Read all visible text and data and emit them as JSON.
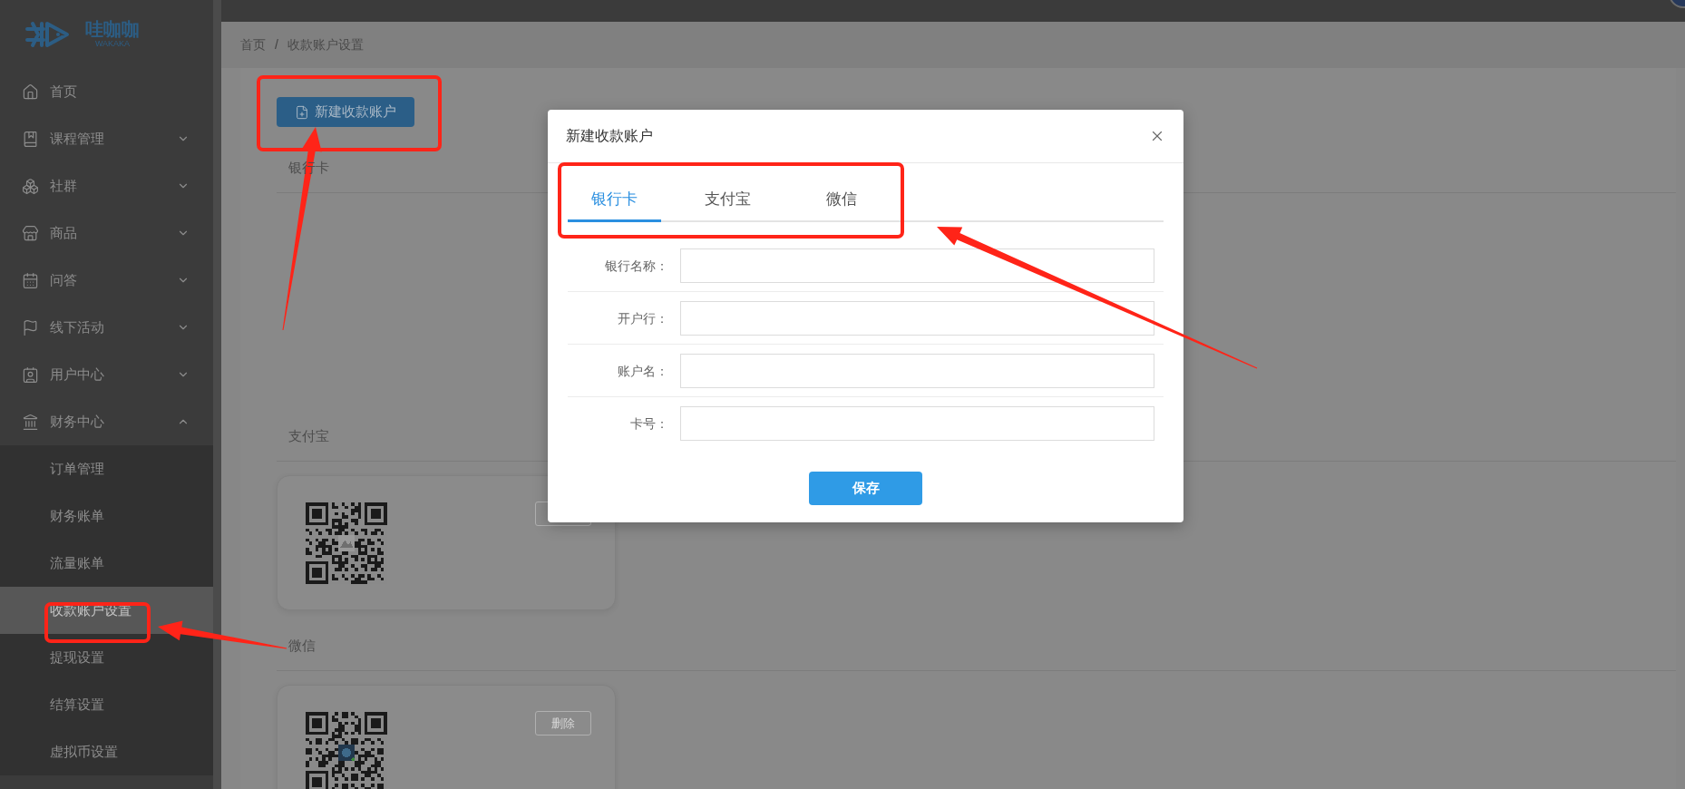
{
  "logo": {
    "text": "哇咖咖",
    "subtext": "WAKAKA"
  },
  "sidebar": {
    "items": [
      {
        "label": "首页"
      },
      {
        "label": "课程管理",
        "expanded": false
      },
      {
        "label": "社群",
        "expanded": false
      },
      {
        "label": "商品",
        "expanded": false
      },
      {
        "label": "问答",
        "expanded": false
      },
      {
        "label": "线下活动",
        "expanded": false
      },
      {
        "label": "用户中心",
        "expanded": false
      },
      {
        "label": "财务中心",
        "expanded": true,
        "children": [
          {
            "label": "订单管理",
            "selected": false
          },
          {
            "label": "财务账单",
            "selected": false
          },
          {
            "label": "流量账单",
            "selected": false
          },
          {
            "label": "收款账户设置",
            "selected": true
          },
          {
            "label": "提现设置",
            "selected": false
          },
          {
            "label": "结算设置",
            "selected": false
          },
          {
            "label": "虚拟币设置",
            "selected": false
          }
        ]
      }
    ]
  },
  "breadcrumb": {
    "items": [
      "首页",
      "收款账户设置"
    ],
    "separator": "/"
  },
  "new_account_button": "新建收款账户",
  "sections": [
    {
      "title": "银行卡"
    },
    {
      "title": "支付宝",
      "accounts": [
        {
          "kind": "qr"
        }
      ]
    },
    {
      "title": "微信",
      "accounts": [
        {
          "kind": "qr",
          "delete_label": "删除"
        }
      ]
    }
  ],
  "modal": {
    "title": "新建收款账户",
    "tabs": [
      {
        "label": "银行卡",
        "selected": true
      },
      {
        "label": "支付宝",
        "selected": false
      },
      {
        "label": "微信",
        "selected": false
      }
    ],
    "fields": [
      {
        "label": "银行名称："
      },
      {
        "label": "开户行："
      },
      {
        "label": "账户名："
      },
      {
        "label": "卡号："
      }
    ],
    "save_button": "保存"
  }
}
